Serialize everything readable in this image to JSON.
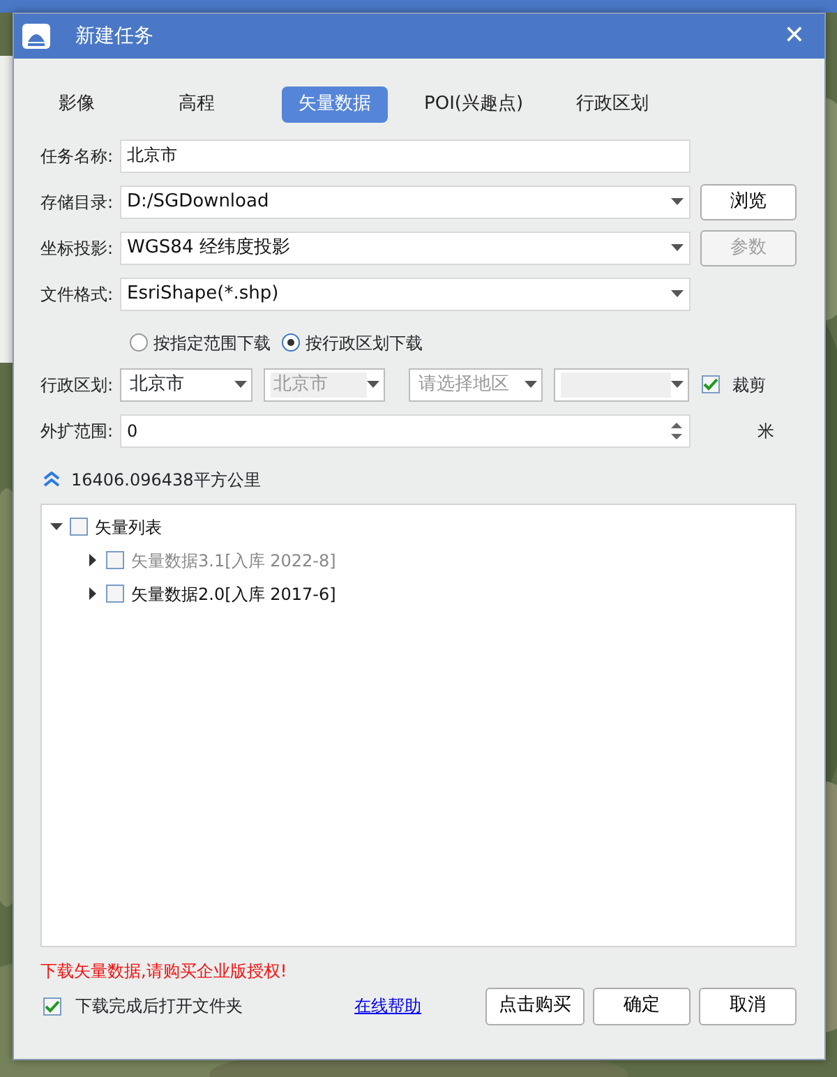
{
  "window": {
    "title": "新建任务",
    "close": "✕"
  },
  "tabs": [
    {
      "label": "影像",
      "selected": false
    },
    {
      "label": "高程",
      "selected": false
    },
    {
      "label": "矢量数据",
      "selected": true
    },
    {
      "label": "POI(兴趣点)",
      "selected": false
    },
    {
      "label": "行政区划",
      "selected": false
    }
  ],
  "fields": [
    {
      "kind": "text",
      "label": "任务名称:",
      "value": "北京市"
    },
    {
      "kind": "combo",
      "label": "存储目录:",
      "value": "D:/SGDownload",
      "button": {
        "label": "浏览",
        "disabled": false
      }
    },
    {
      "kind": "combo",
      "label": "坐标投影:",
      "value": "WGS84 经纬度投影",
      "button": {
        "label": "参数",
        "disabled": true
      }
    },
    {
      "kind": "combo",
      "label": "文件格式:",
      "value": "EsriShape(*.shp)"
    }
  ],
  "download_modes": [
    {
      "label": "按指定范围下载",
      "selected": false
    },
    {
      "label": "按行政区划下载",
      "selected": true
    }
  ],
  "region": {
    "label": "行政区划:",
    "selects": [
      {
        "value": "北京市",
        "disabled": false
      },
      {
        "value": "北京市",
        "disabled": true
      },
      {
        "placeholder": "请选择地区",
        "disabled": false
      },
      {
        "disabled": true
      }
    ],
    "clip": {
      "label": "裁剪",
      "checked": true
    }
  },
  "expand": {
    "label": "外扩范围:",
    "value": "0",
    "unit": "米"
  },
  "area": {
    "collapsed": true,
    "text": "16406.096438平方公里"
  },
  "tree": [
    {
      "label": "矢量列表",
      "expanded": true,
      "checked": false,
      "disabled": false,
      "children": [
        {
          "label": "矢量数据3.1[入库 2022-8]",
          "expanded": false,
          "checked": false,
          "disabled": true
        },
        {
          "label": "矢量数据2.0[入库 2017-6]",
          "expanded": false,
          "checked": false,
          "disabled": false
        }
      ]
    }
  ],
  "warning": "下载矢量数据,请购买企业版授权!",
  "open_folder": {
    "label": "下载完成后打开文件夹",
    "checked": true
  },
  "help_link": "在线帮助",
  "buttons": [
    "点击购买",
    "确定",
    "取消"
  ]
}
